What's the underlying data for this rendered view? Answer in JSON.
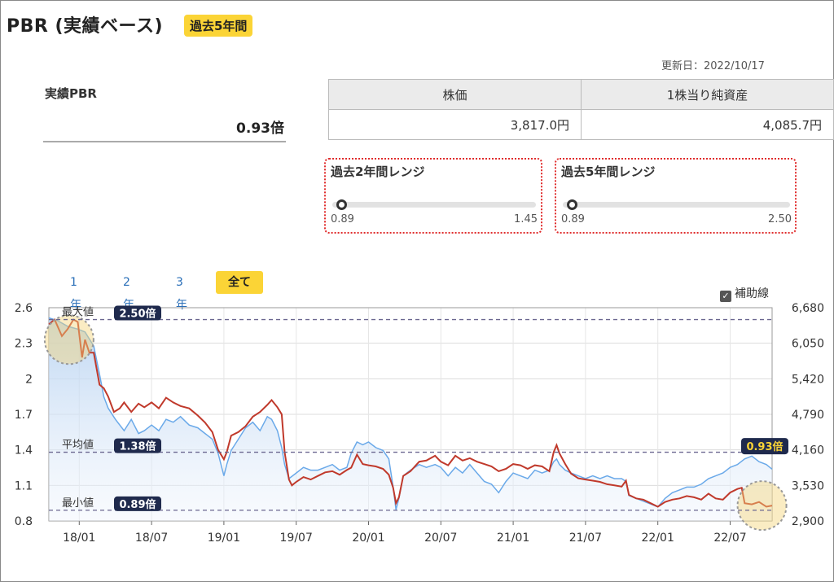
{
  "header": {
    "title": "PBR (実績ベース)",
    "badge": "過去5年間",
    "updated": "更新日：2022/10/17"
  },
  "pbr": {
    "label": "実績PBR",
    "value": "0.93倍"
  },
  "price_table": {
    "headers": [
      "株価",
      "1株当り純資産"
    ],
    "values": [
      "3,817.0円",
      "4,085.7円"
    ]
  },
  "ranges": [
    {
      "title": "過去2年間レンジ",
      "min": "0.89",
      "max": "1.45",
      "level": 0.0
    },
    {
      "title": "過去5年間レンジ",
      "min": "0.89",
      "max": "2.50",
      "level": 0.0
    }
  ],
  "tabs": [
    "1年",
    "2年",
    "3年",
    "全て"
  ],
  "active_tab": "全て",
  "aux_label": "補助線",
  "colors": {
    "pbr_line": "#c0392b",
    "price_line": "#6aa9e9",
    "accent": "#fbd436",
    "badge_dark": "#1f2a4d",
    "range_border": "#e02c2c"
  },
  "chart_data": {
    "type": "line",
    "x_ticks": [
      "18/01",
      "18/07",
      "19/01",
      "19/07",
      "20/01",
      "20/07",
      "21/01",
      "21/07",
      "22/01",
      "22/07"
    ],
    "x_tick_pos": [
      2018.0,
      2018.5,
      2019.0,
      2019.5,
      2020.0,
      2020.5,
      2021.0,
      2021.5,
      2022.0,
      2022.5
    ],
    "x_range": [
      2017.79,
      2022.79
    ],
    "y_left": {
      "ticks": [
        "2.6",
        "2.3",
        "2",
        "1.7",
        "1.4",
        "1.1",
        "0.8"
      ],
      "range": [
        0.8,
        2.6
      ]
    },
    "y_right": {
      "ticks": [
        "6,680",
        "6,050",
        "5,420",
        "4,790",
        "4,160",
        "3,530",
        "2,900"
      ],
      "range": [
        2900,
        6680
      ]
    },
    "ref_lines": [
      {
        "label": "最大値",
        "badge": "2.50倍",
        "value": 2.5
      },
      {
        "label": "平均値",
        "badge": "1.38倍",
        "value": 1.38
      },
      {
        "label": "最小値",
        "badge": "0.89倍",
        "value": 0.89
      }
    ],
    "current_badge": "0.93倍",
    "grid": true,
    "series": [
      {
        "axis": "left",
        "color": "#c0392b",
        "points": [
          [
            2017.79,
            2.46
          ],
          [
            2017.83,
            2.5
          ],
          [
            2017.88,
            2.36
          ],
          [
            2017.92,
            2.42
          ],
          [
            2017.96,
            2.5
          ],
          [
            2017.99,
            2.48
          ],
          [
            2018.02,
            2.18
          ],
          [
            2018.04,
            2.33
          ],
          [
            2018.07,
            2.22
          ],
          [
            2018.1,
            2.22
          ],
          [
            2018.14,
            1.95
          ],
          [
            2018.17,
            1.92
          ],
          [
            2018.2,
            1.85
          ],
          [
            2018.24,
            1.72
          ],
          [
            2018.28,
            1.75
          ],
          [
            2018.31,
            1.8
          ],
          [
            2018.36,
            1.72
          ],
          [
            2018.41,
            1.79
          ],
          [
            2018.45,
            1.76
          ],
          [
            2018.5,
            1.8
          ],
          [
            2018.55,
            1.75
          ],
          [
            2018.6,
            1.84
          ],
          [
            2018.65,
            1.8
          ],
          [
            2018.7,
            1.77
          ],
          [
            2018.76,
            1.75
          ],
          [
            2018.82,
            1.69
          ],
          [
            2018.87,
            1.63
          ],
          [
            2018.92,
            1.55
          ],
          [
            2018.96,
            1.4
          ],
          [
            2019.0,
            1.32
          ],
          [
            2019.02,
            1.38
          ],
          [
            2019.05,
            1.52
          ],
          [
            2019.1,
            1.55
          ],
          [
            2019.15,
            1.6
          ],
          [
            2019.2,
            1.68
          ],
          [
            2019.25,
            1.72
          ],
          [
            2019.3,
            1.78
          ],
          [
            2019.33,
            1.82
          ],
          [
            2019.37,
            1.76
          ],
          [
            2019.4,
            1.7
          ],
          [
            2019.42,
            1.38
          ],
          [
            2019.45,
            1.15
          ],
          [
            2019.47,
            1.1
          ],
          [
            2019.5,
            1.13
          ],
          [
            2019.55,
            1.17
          ],
          [
            2019.6,
            1.15
          ],
          [
            2019.65,
            1.18
          ],
          [
            2019.7,
            1.21
          ],
          [
            2019.75,
            1.22
          ],
          [
            2019.8,
            1.19
          ],
          [
            2019.85,
            1.23
          ],
          [
            2019.88,
            1.25
          ],
          [
            2019.92,
            1.36
          ],
          [
            2019.96,
            1.28
          ],
          [
            2020.0,
            1.27
          ],
          [
            2020.05,
            1.26
          ],
          [
            2020.1,
            1.24
          ],
          [
            2020.14,
            1.19
          ],
          [
            2020.17,
            1.08
          ],
          [
            2020.19,
            0.95
          ],
          [
            2020.21,
            1.0
          ],
          [
            2020.24,
            1.18
          ],
          [
            2020.29,
            1.22
          ],
          [
            2020.35,
            1.3
          ],
          [
            2020.4,
            1.31
          ],
          [
            2020.46,
            1.35
          ],
          [
            2020.5,
            1.3
          ],
          [
            2020.55,
            1.27
          ],
          [
            2020.6,
            1.35
          ],
          [
            2020.65,
            1.31
          ],
          [
            2020.7,
            1.33
          ],
          [
            2020.75,
            1.3
          ],
          [
            2020.8,
            1.28
          ],
          [
            2020.85,
            1.26
          ],
          [
            2020.9,
            1.22
          ],
          [
            2020.95,
            1.24
          ],
          [
            2021.0,
            1.28
          ],
          [
            2021.05,
            1.27
          ],
          [
            2021.1,
            1.24
          ],
          [
            2021.15,
            1.27
          ],
          [
            2021.2,
            1.26
          ],
          [
            2021.25,
            1.22
          ],
          [
            2021.28,
            1.38
          ],
          [
            2021.3,
            1.44
          ],
          [
            2021.32,
            1.37
          ],
          [
            2021.36,
            1.28
          ],
          [
            2021.4,
            1.2
          ],
          [
            2021.45,
            1.16
          ],
          [
            2021.5,
            1.15
          ],
          [
            2021.55,
            1.14
          ],
          [
            2021.6,
            1.13
          ],
          [
            2021.65,
            1.11
          ],
          [
            2021.7,
            1.1
          ],
          [
            2021.75,
            1.09
          ],
          [
            2021.78,
            1.14
          ],
          [
            2021.8,
            1.02
          ],
          [
            2021.85,
            0.99
          ],
          [
            2021.9,
            0.98
          ],
          [
            2021.95,
            0.95
          ],
          [
            2022.0,
            0.92
          ],
          [
            2022.05,
            0.96
          ],
          [
            2022.1,
            0.98
          ],
          [
            2022.15,
            0.99
          ],
          [
            2022.2,
            1.01
          ],
          [
            2022.25,
            1.0
          ],
          [
            2022.3,
            0.98
          ],
          [
            2022.35,
            1.03
          ],
          [
            2022.4,
            0.99
          ],
          [
            2022.45,
            0.98
          ],
          [
            2022.5,
            1.04
          ],
          [
            2022.55,
            1.07
          ],
          [
            2022.58,
            1.08
          ],
          [
            2022.6,
            0.95
          ],
          [
            2022.65,
            0.94
          ],
          [
            2022.7,
            0.96
          ],
          [
            2022.75,
            0.92
          ],
          [
            2022.79,
            0.93
          ]
        ]
      },
      {
        "axis": "right",
        "color": "#6aa9e9",
        "points": [
          [
            2017.79,
            6500
          ],
          [
            2017.85,
            6450
          ],
          [
            2017.92,
            6350
          ],
          [
            2017.99,
            6300
          ],
          [
            2018.04,
            6250
          ],
          [
            2018.1,
            6000
          ],
          [
            2018.14,
            5500
          ],
          [
            2018.17,
            5100
          ],
          [
            2018.2,
            4900
          ],
          [
            2018.25,
            4700
          ],
          [
            2018.31,
            4500
          ],
          [
            2018.36,
            4700
          ],
          [
            2018.41,
            4450
          ],
          [
            2018.45,
            4500
          ],
          [
            2018.5,
            4600
          ],
          [
            2018.55,
            4500
          ],
          [
            2018.6,
            4700
          ],
          [
            2018.65,
            4650
          ],
          [
            2018.7,
            4750
          ],
          [
            2018.76,
            4600
          ],
          [
            2018.82,
            4550
          ],
          [
            2018.87,
            4450
          ],
          [
            2018.92,
            4350
          ],
          [
            2018.96,
            4100
          ],
          [
            2019.0,
            3700
          ],
          [
            2019.02,
            3900
          ],
          [
            2019.05,
            4150
          ],
          [
            2019.1,
            4350
          ],
          [
            2019.15,
            4550
          ],
          [
            2019.2,
            4650
          ],
          [
            2019.25,
            4500
          ],
          [
            2019.3,
            4750
          ],
          [
            2019.33,
            4700
          ],
          [
            2019.37,
            4500
          ],
          [
            2019.4,
            4200
          ],
          [
            2019.42,
            3900
          ],
          [
            2019.45,
            3650
          ],
          [
            2019.5,
            3750
          ],
          [
            2019.55,
            3850
          ],
          [
            2019.6,
            3800
          ],
          [
            2019.65,
            3800
          ],
          [
            2019.7,
            3850
          ],
          [
            2019.75,
            3900
          ],
          [
            2019.8,
            3800
          ],
          [
            2019.85,
            3850
          ],
          [
            2019.88,
            4100
          ],
          [
            2019.92,
            4300
          ],
          [
            2019.96,
            4250
          ],
          [
            2020.0,
            4300
          ],
          [
            2020.05,
            4200
          ],
          [
            2020.1,
            4150
          ],
          [
            2020.14,
            4000
          ],
          [
            2020.17,
            3500
          ],
          [
            2020.19,
            3100
          ],
          [
            2020.21,
            3300
          ],
          [
            2020.24,
            3700
          ],
          [
            2020.29,
            3800
          ],
          [
            2020.35,
            3900
          ],
          [
            2020.4,
            3850
          ],
          [
            2020.46,
            3900
          ],
          [
            2020.5,
            3850
          ],
          [
            2020.55,
            3700
          ],
          [
            2020.6,
            3850
          ],
          [
            2020.65,
            3750
          ],
          [
            2020.7,
            3900
          ],
          [
            2020.75,
            3750
          ],
          [
            2020.8,
            3600
          ],
          [
            2020.85,
            3550
          ],
          [
            2020.9,
            3400
          ],
          [
            2020.95,
            3600
          ],
          [
            2021.0,
            3750
          ],
          [
            2021.05,
            3700
          ],
          [
            2021.1,
            3650
          ],
          [
            2021.15,
            3800
          ],
          [
            2021.2,
            3750
          ],
          [
            2021.25,
            3800
          ],
          [
            2021.28,
            3950
          ],
          [
            2021.3,
            4000
          ],
          [
            2021.32,
            3900
          ],
          [
            2021.36,
            3800
          ],
          [
            2021.4,
            3750
          ],
          [
            2021.45,
            3700
          ],
          [
            2021.5,
            3650
          ],
          [
            2021.55,
            3700
          ],
          [
            2021.6,
            3650
          ],
          [
            2021.65,
            3700
          ],
          [
            2021.7,
            3650
          ],
          [
            2021.75,
            3650
          ],
          [
            2021.78,
            3600
          ],
          [
            2021.8,
            3350
          ],
          [
            2021.85,
            3300
          ],
          [
            2021.9,
            3250
          ],
          [
            2021.95,
            3200
          ],
          [
            2022.0,
            3150
          ],
          [
            2022.05,
            3300
          ],
          [
            2022.1,
            3400
          ],
          [
            2022.15,
            3450
          ],
          [
            2022.2,
            3500
          ],
          [
            2022.25,
            3500
          ],
          [
            2022.3,
            3550
          ],
          [
            2022.35,
            3650
          ],
          [
            2022.4,
            3700
          ],
          [
            2022.45,
            3750
          ],
          [
            2022.5,
            3850
          ],
          [
            2022.55,
            3900
          ],
          [
            2022.6,
            4000
          ],
          [
            2022.65,
            4050
          ],
          [
            2022.7,
            3950
          ],
          [
            2022.75,
            3900
          ],
          [
            2022.79,
            3817
          ]
        ]
      }
    ]
  }
}
